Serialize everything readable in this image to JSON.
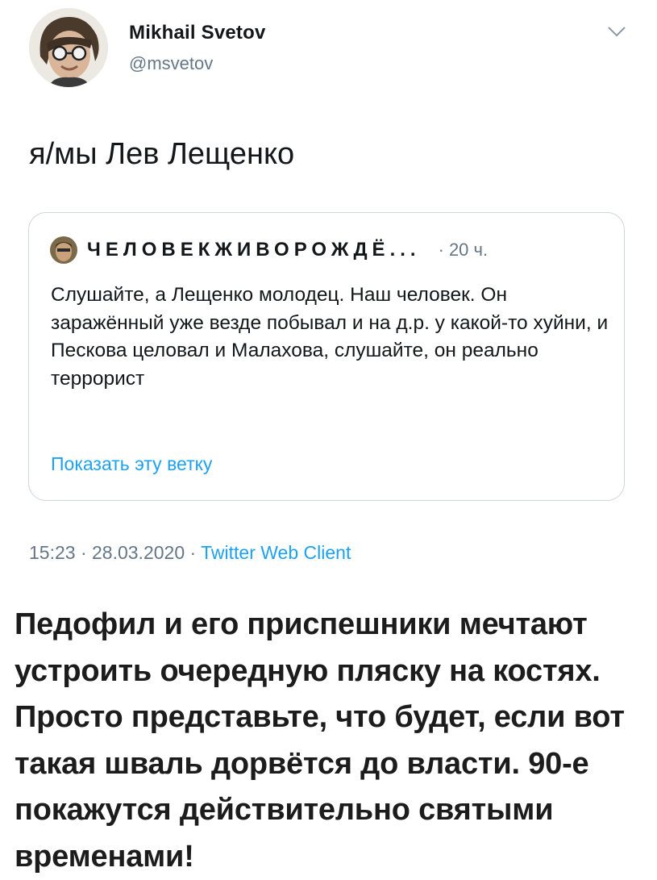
{
  "tweet": {
    "author_name": "Mikhail Svetov",
    "author_handle": "@msvetov",
    "text": "я/мы Лев Лещенко",
    "quoted": {
      "author_name": "ЧЕЛОВЕКЖИВОРОЖДЁ...",
      "separator": "·",
      "time": "20 ч.",
      "text": "Слушайте, а Лещенко молодец. Наш человек. Он заражённый уже везде побывал и на д.р. у какой-то хуйни, и Пескова целовал и Малахова, слушайте, он реально террорист",
      "thread_link": "Показать эту ветку"
    },
    "timestamp": "15:23 · 28.03.2020 · ",
    "client": "Twitter Web Client",
    "icons": {
      "menu": "chevron-down-icon"
    }
  },
  "caption": "Педофил и его приспешники мечтают устроить очередную пляску на костях. Просто представьте, что будет, если вот такая шваль дорвётся до власти. 90-е покажутся действительно святыми временами!",
  "colors": {
    "link": "#1da1f2",
    "secondary": "#657786",
    "border": "#ccd6dd"
  }
}
